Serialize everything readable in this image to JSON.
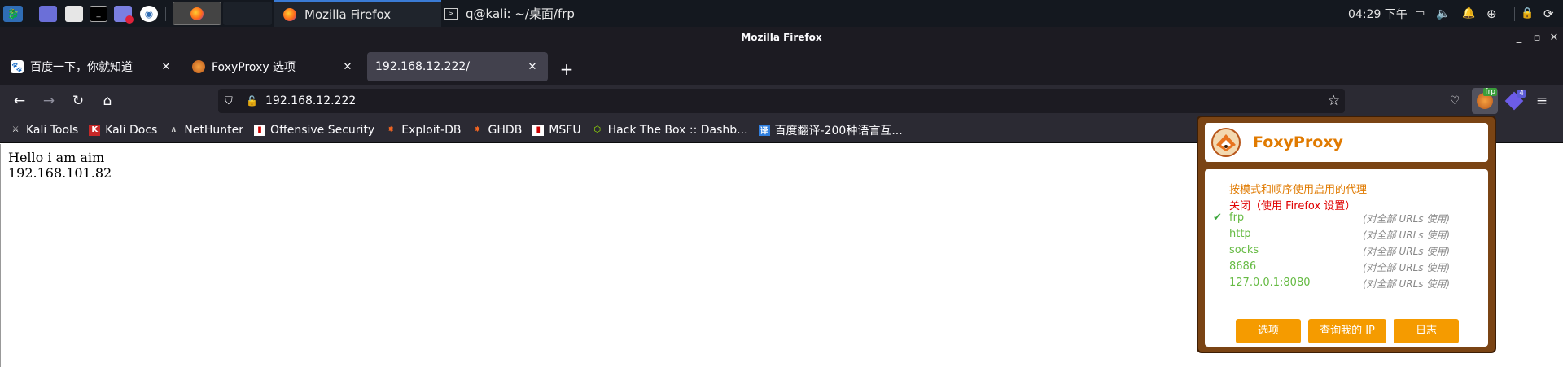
{
  "panel": {
    "tasks": [
      {
        "label": "Mozilla Firefox"
      },
      {
        "label": "q@kali: ~/桌面/frp"
      }
    ],
    "clock": "04:29 下午"
  },
  "window": {
    "title": "Mozilla Firefox"
  },
  "tabs": [
    {
      "label": "百度一下，你就知道"
    },
    {
      "label": "FoxyProxy 选项"
    },
    {
      "label": "192.168.12.222/"
    }
  ],
  "urlbar": {
    "value": "192.168.12.222"
  },
  "toolbar": {
    "foxyproxy_badge": "frp",
    "ext_badge": "4"
  },
  "bookmarks": [
    {
      "label": "Kali Tools",
      "icon": "kali-icon"
    },
    {
      "label": "Kali Docs",
      "icon": "kali-docs-icon"
    },
    {
      "label": "NetHunter",
      "icon": "nethunter-icon"
    },
    {
      "label": "Offensive Security",
      "icon": "offsec-icon"
    },
    {
      "label": "Exploit-DB",
      "icon": "exploitdb-icon"
    },
    {
      "label": "GHDB",
      "icon": "ghdb-icon"
    },
    {
      "label": "MSFU",
      "icon": "msfu-icon"
    },
    {
      "label": "Hack The Box :: Dashb...",
      "icon": "htb-icon"
    },
    {
      "label": "百度翻译-200种语言互...",
      "icon": "baidu-translate-icon"
    }
  ],
  "page": {
    "line1": "Hello i am aim",
    "line2": "192.168.101.82"
  },
  "foxyproxy": {
    "title": "FoxyProxy",
    "mode_patterns": "按模式和顺序使用启用的代理",
    "mode_off": "关闭（使用 Firefox 设置）",
    "selected_check": "✔",
    "proxies": [
      {
        "name": "frp",
        "use": "(对全部 URLs 使用)"
      },
      {
        "name": "http",
        "use": "(对全部 URLs 使用)"
      },
      {
        "name": "socks",
        "use": "(对全部 URLs 使用)"
      },
      {
        "name": "8686",
        "use": "(对全部 URLs 使用)"
      },
      {
        "name": "127.0.0.1:8080",
        "use": "(对全部 URLs 使用)"
      }
    ],
    "buttons": {
      "options": "选项",
      "myip": "查询我的 IP",
      "log": "日志"
    },
    "colors": {
      "accent": "#f59b00",
      "mode_patterns": "#e07a00",
      "mode_off": "#e00000",
      "proxy": "#66bb44"
    }
  }
}
